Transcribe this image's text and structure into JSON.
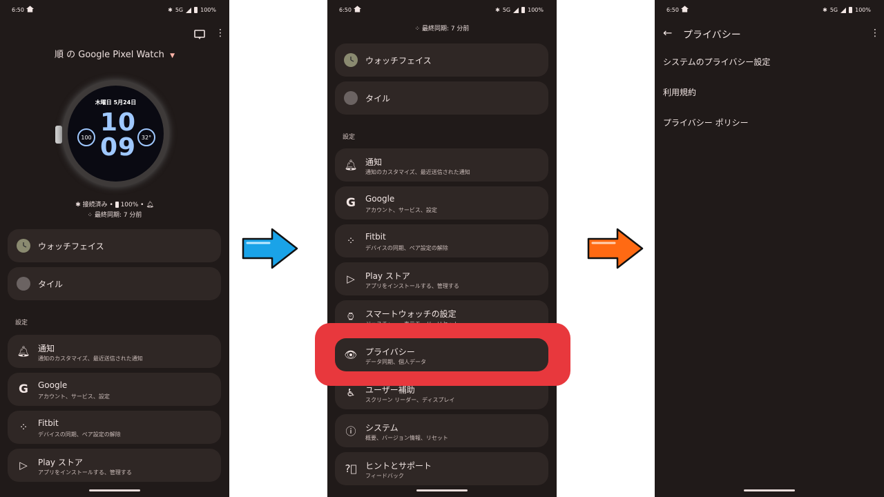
{
  "status": {
    "time": "6:50",
    "network": "5G",
    "battery": "100%"
  },
  "screen1": {
    "device_name": "順 の Google Pixel Watch",
    "watch": {
      "date": "木曜日 5月24日",
      "hour": "10",
      "minute": "09",
      "battery_comp": "100",
      "temp_comp": "32°"
    },
    "conn_status": "接続済み",
    "battery": "100%",
    "sync": "最終同期: 7 分前",
    "items": [
      {
        "title": "ウォッチフェイス"
      },
      {
        "title": "タイル"
      }
    ],
    "section": "設定",
    "settings": [
      {
        "title": "通知",
        "sub": "通知のカスタマイズ、最近送信された通知"
      },
      {
        "title": "Google",
        "sub": "アカウント、サービス、設定"
      },
      {
        "title": "Fitbit",
        "sub": "デバイスの同期、ペア設定の解除"
      },
      {
        "title": "Play ストア",
        "sub": "アプリをインストールする、管理する"
      }
    ]
  },
  "screen2": {
    "sync": "最終同期: 7 分前",
    "items": [
      {
        "title": "ウォッチフェイス"
      },
      {
        "title": "タイル"
      }
    ],
    "section": "設定",
    "settings": [
      {
        "title": "通知",
        "sub": "通知のカスタマイズ、最近送信された通知"
      },
      {
        "title": "Google",
        "sub": "アカウント、サービス、設定"
      },
      {
        "title": "Fitbit",
        "sub": "デバイスの同期、ペア設定の解除"
      },
      {
        "title": "Play ストア",
        "sub": "アプリをインストールする、管理する"
      },
      {
        "title": "スマートウォッチの設定",
        "sub": "ジェスチャー、表示モード、リセット"
      },
      {
        "title": "プライバシー",
        "sub": "データ同期、個人データ"
      },
      {
        "title": "ユーザー補助",
        "sub": "スクリーン リーダー、ディスプレイ"
      },
      {
        "title": "システム",
        "sub": "概要、バージョン情報、リセット"
      },
      {
        "title": "ヒントとサポート",
        "sub": "フィードバック"
      }
    ]
  },
  "screen3": {
    "title": "プライバシー",
    "items": [
      "システムのプライバシー設定",
      "利用規約",
      "プライバシー ポリシー"
    ]
  },
  "colors": {
    "bg": "#201a19",
    "card": "#2f2725",
    "highlight": "#e8383d",
    "arrow_blue": "#1aa3e8",
    "arrow_orange": "#ff6a13"
  }
}
